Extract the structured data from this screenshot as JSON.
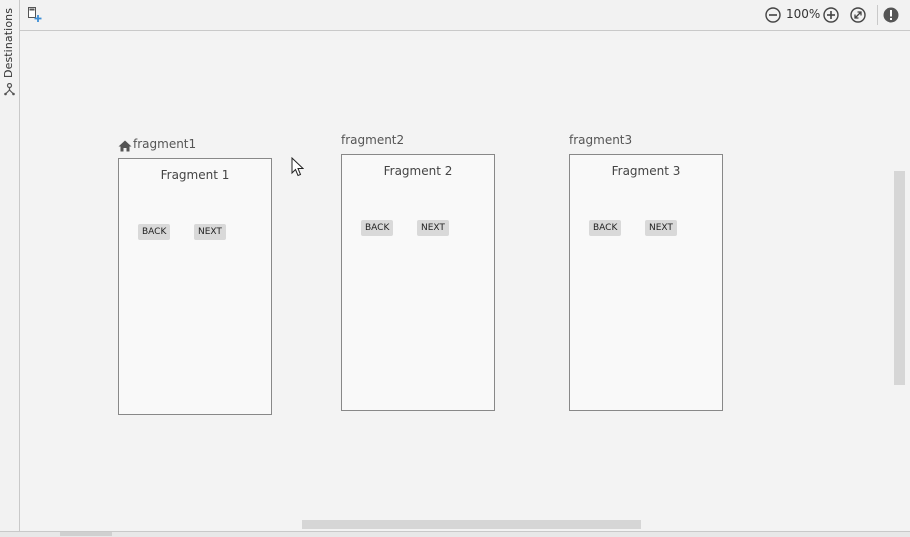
{
  "side_panel": {
    "tab_label": "Destinations",
    "tab_icon": "destinations-icon"
  },
  "toolbar": {
    "new_destination_icon": "new-destination-icon",
    "zoom_out_icon": "zoom-out-icon",
    "zoom_level": "100%",
    "zoom_in_icon": "zoom-in-icon",
    "zoom_fit_icon": "zoom-to-fit-icon",
    "warning_icon": "warning-icon"
  },
  "destinations": [
    {
      "title": "fragment1",
      "is_start": true,
      "heading": "Fragment 1",
      "back_label": "BACK",
      "next_label": "NEXT"
    },
    {
      "title": "fragment2",
      "is_start": false,
      "heading": "Fragment 2",
      "back_label": "BACK",
      "next_label": "NEXT"
    },
    {
      "title": "fragment3",
      "is_start": false,
      "heading": "Fragment 3",
      "back_label": "BACK",
      "next_label": "NEXT"
    }
  ],
  "colors": {
    "background": "#f3f3f3",
    "fragment_border": "#888888",
    "button_bg": "#d9d9d9",
    "accent": "#3d8fd6"
  }
}
